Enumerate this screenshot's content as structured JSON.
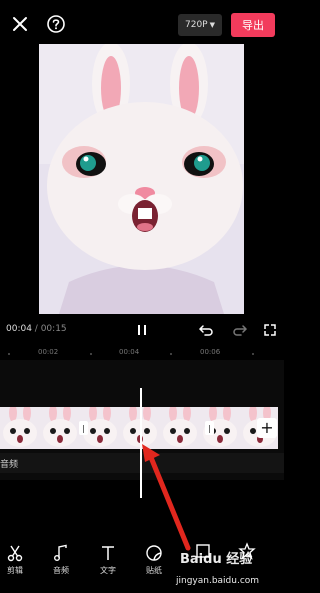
{
  "header": {
    "resolution_label": "720P",
    "export_label": "导出"
  },
  "playback": {
    "current_time": "00:04",
    "separator": " / ",
    "total_time": "00:15"
  },
  "ruler": {
    "ticks": [
      "00:02",
      "00:04",
      "00:06"
    ]
  },
  "track": {
    "audio_label": "音频"
  },
  "toolbar": {
    "items": [
      {
        "label": "剪辑",
        "icon": "scissors-icon"
      },
      {
        "label": "音频",
        "icon": "music-note-icon"
      },
      {
        "label": "文字",
        "icon": "text-icon"
      },
      {
        "label": "贴纸",
        "icon": "sticker-icon"
      }
    ]
  },
  "watermark": {
    "brand": "Baidu 经验",
    "url": "jingyan.baidu.com"
  },
  "colors": {
    "accent": "#f23b5c",
    "background": "#000000"
  }
}
